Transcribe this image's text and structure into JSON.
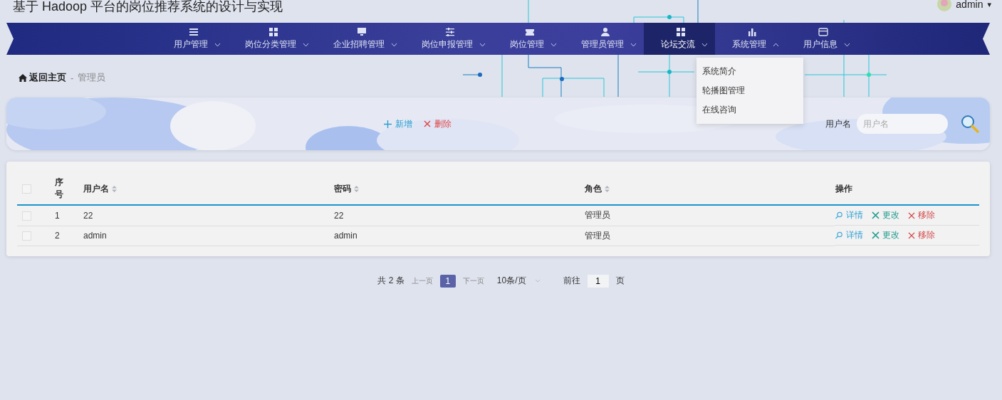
{
  "header": {
    "title": "基于 Hadoop 平台的岗位推荐系统的设计与实现",
    "user": "admin",
    "caret": "▾"
  },
  "nav": [
    {
      "kind": "list",
      "label": "用户管理",
      "highlighted": false,
      "expanded": false
    },
    {
      "kind": "grid",
      "label": "岗位分类管理",
      "highlighted": false,
      "expanded": false
    },
    {
      "kind": "monitor",
      "label": "企业招聘管理",
      "highlighted": false,
      "expanded": false
    },
    {
      "kind": "sliders",
      "label": "岗位申报管理",
      "highlighted": false,
      "expanded": false
    },
    {
      "kind": "ticket",
      "label": "岗位管理",
      "highlighted": false,
      "expanded": false
    },
    {
      "kind": "person",
      "label": "管理员管理",
      "highlighted": false,
      "expanded": false
    },
    {
      "kind": "grid",
      "label": "论坛交流",
      "highlighted": true,
      "expanded": false
    },
    {
      "kind": "chart",
      "label": "系统管理",
      "highlighted": false,
      "expanded": true,
      "menu": [
        "系统简介",
        "轮播图管理",
        "在线咨询"
      ]
    },
    {
      "kind": "card",
      "label": "用户信息",
      "highlighted": false,
      "expanded": false
    }
  ],
  "breadcrumb": {
    "home": "返回主页",
    "separator": "-",
    "current": "管理员"
  },
  "toolbar": {
    "add": "新增",
    "delete": "删除",
    "search_label": "用户名",
    "search": {
      "placeholder": "用户名"
    }
  },
  "table": {
    "all_checked": false,
    "columns": [
      {
        "label": "序号",
        "sortable": false
      },
      {
        "label": "用户名",
        "sortable": true
      },
      {
        "label": "密码",
        "sortable": true
      },
      {
        "label": "角色",
        "sortable": true
      },
      {
        "label": "操作",
        "sortable": false
      }
    ],
    "rows": [
      {
        "cells": [
          "1",
          "22",
          "22",
          "管理员"
        ],
        "checked": false,
        "actions": [
          "详情",
          "更改",
          "移除"
        ]
      },
      {
        "cells": [
          "2",
          "admin",
          "admin",
          "管理员"
        ],
        "checked": false,
        "actions": [
          "详情",
          "更改",
          "移除"
        ]
      }
    ]
  },
  "pagination": {
    "total": "共 2 条",
    "prev": "上一页",
    "pages": [
      {
        "label": "1",
        "selected": true
      }
    ],
    "next": "下一页",
    "size": "10条/页",
    "goto": "前往",
    "goto_value": "1",
    "page_unit": "页"
  }
}
